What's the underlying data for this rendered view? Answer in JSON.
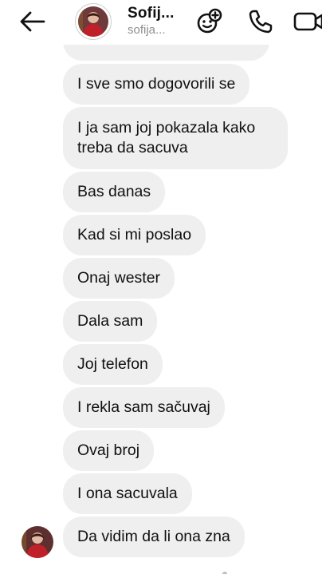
{
  "header": {
    "back_icon": "arrow-left-icon",
    "contact_name": "Sofij...",
    "contact_handle": "sofija...",
    "icons": [
      "effects-add-icon",
      "phone-icon",
      "video-icon"
    ]
  },
  "messages": [
    {
      "text": ""
    },
    {
      "text": "I sve smo dogovorili se"
    },
    {
      "text": "I ja sam joj pokazala kako treba da sacuva"
    },
    {
      "text": "Bas danas"
    },
    {
      "text": "Kad si mi poslao"
    },
    {
      "text": "Onaj wester"
    },
    {
      "text": "Dala sam"
    },
    {
      "text": "Joj telefon"
    },
    {
      "text": "I rekla sam sačuvaj"
    },
    {
      "text": "Ovaj broj"
    },
    {
      "text": "I ona sacuvala"
    },
    {
      "text": "Da vidim da li ona zna"
    }
  ],
  "colors": {
    "bubble": "#efefef",
    "text": "#111111",
    "muted": "#8e8e8e",
    "background": "#ffffff"
  }
}
